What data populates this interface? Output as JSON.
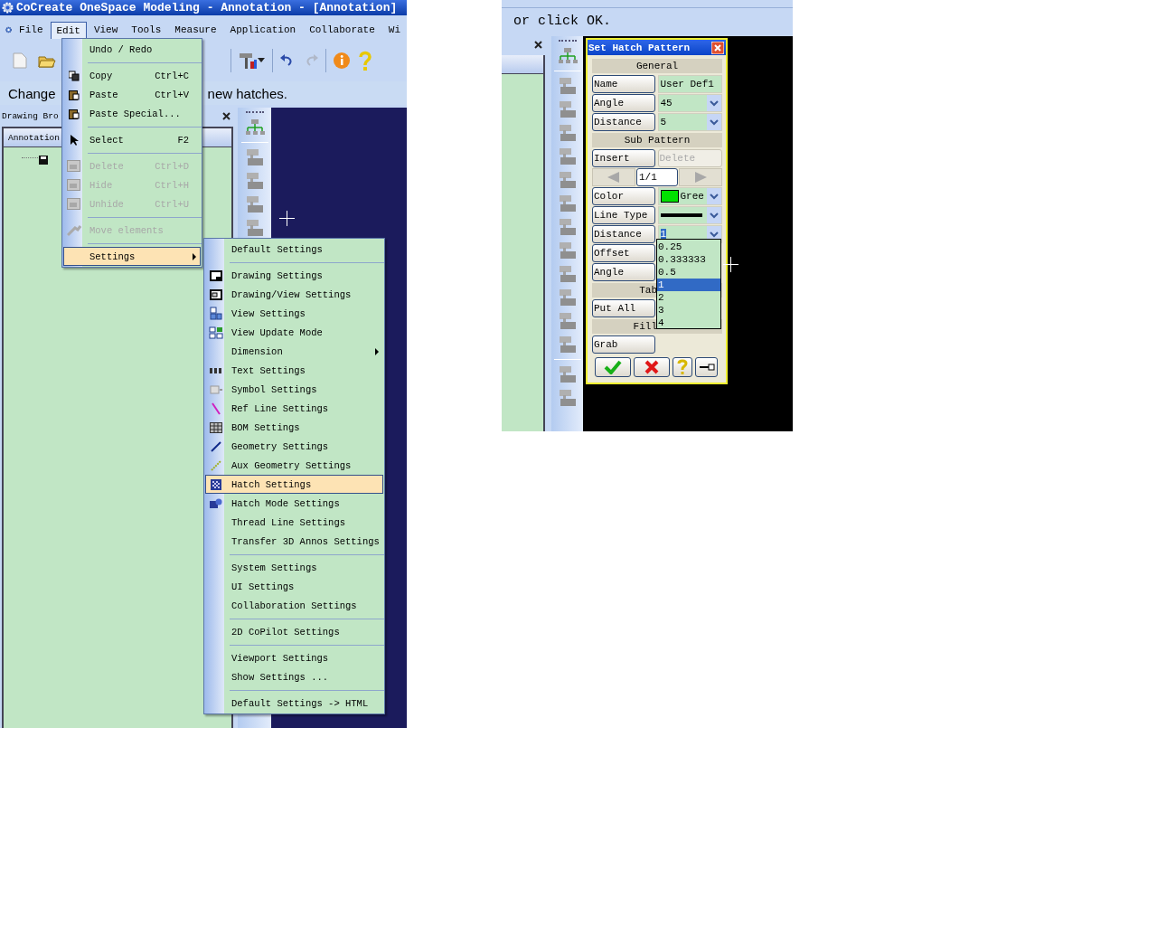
{
  "left_window": {
    "title": "CoCreate OneSpace Modeling - Annotation - [Annotation]",
    "menu_bar": [
      {
        "label": "File",
        "selected": false
      },
      {
        "label": "Edit",
        "selected": true
      },
      {
        "label": "View",
        "selected": false
      },
      {
        "label": "Tools",
        "selected": false
      },
      {
        "label": "Measure",
        "selected": false
      },
      {
        "label": "Application",
        "selected": false
      },
      {
        "label": "Collaborate",
        "selected": false
      },
      {
        "label": "Wi",
        "selected": false
      }
    ],
    "prompt": [
      "Change",
      "new hatches."
    ],
    "browser": {
      "title": "Drawing Bro",
      "tab": "Annotation"
    },
    "edit_menu": [
      {
        "kind": "item",
        "label": "Undo / Redo",
        "disabled": false,
        "selected": false
      },
      {
        "kind": "separator"
      },
      {
        "kind": "item",
        "label": "Copy",
        "shortcut": "Ctrl+C",
        "disabled": false,
        "selected": false
      },
      {
        "kind": "item",
        "label": "Paste",
        "shortcut": "Ctrl+V",
        "disabled": false,
        "selected": false
      },
      {
        "kind": "item",
        "label": "Paste Special...",
        "disabled": false,
        "selected": false
      },
      {
        "kind": "separator"
      },
      {
        "kind": "item",
        "label": "Select",
        "shortcut": "F2",
        "disabled": false,
        "selected": false
      },
      {
        "kind": "separator"
      },
      {
        "kind": "item",
        "label": "Delete",
        "shortcut": "Ctrl+D",
        "disabled": true,
        "selected": false
      },
      {
        "kind": "item",
        "label": "Hide",
        "shortcut": "Ctrl+H",
        "disabled": true,
        "selected": false
      },
      {
        "kind": "item",
        "label": "Unhide",
        "shortcut": "Ctrl+U",
        "disabled": true,
        "selected": false
      },
      {
        "kind": "separator"
      },
      {
        "kind": "item",
        "label": "Move elements",
        "disabled": true,
        "selected": false
      },
      {
        "kind": "separator"
      },
      {
        "kind": "submenu",
        "label": "Settings",
        "disabled": false,
        "selected": true
      }
    ],
    "settings_menu": [
      {
        "kind": "item",
        "label": "Default Settings",
        "disabled": false,
        "selected": false
      },
      {
        "kind": "separator"
      },
      {
        "kind": "item",
        "label": "Drawing Settings",
        "disabled": false,
        "selected": false
      },
      {
        "kind": "item",
        "label": "Drawing/View Settings",
        "disabled": false,
        "selected": false
      },
      {
        "kind": "item",
        "label": "View Settings",
        "disabled": false,
        "selected": false
      },
      {
        "kind": "item",
        "label": "View Update Mode",
        "disabled": false,
        "selected": false
      },
      {
        "kind": "submenu",
        "label": "Dimension",
        "disabled": false,
        "selected": false
      },
      {
        "kind": "item",
        "label": "Text Settings",
        "disabled": false,
        "selected": false
      },
      {
        "kind": "item",
        "label": "Symbol Settings",
        "disabled": false,
        "selected": false
      },
      {
        "kind": "item",
        "label": "Ref Line Settings",
        "disabled": false,
        "selected": false
      },
      {
        "kind": "item",
        "label": "BOM Settings",
        "disabled": false,
        "selected": false
      },
      {
        "kind": "item",
        "label": "Geometry Settings",
        "disabled": false,
        "selected": false
      },
      {
        "kind": "item",
        "label": "Aux Geometry Settings",
        "disabled": false,
        "selected": false
      },
      {
        "kind": "item",
        "label": "Hatch Settings",
        "disabled": false,
        "selected": true
      },
      {
        "kind": "item",
        "label": "Hatch Mode Settings",
        "disabled": false,
        "selected": false
      },
      {
        "kind": "item",
        "label": "Thread Line Settings",
        "disabled": false,
        "selected": false
      },
      {
        "kind": "item",
        "label": "Transfer 3D Annos Settings",
        "disabled": false,
        "selected": false
      },
      {
        "kind": "separator"
      },
      {
        "kind": "item",
        "label": "System Settings",
        "disabled": false,
        "selected": false
      },
      {
        "kind": "item",
        "label": "UI Settings",
        "disabled": false,
        "selected": false
      },
      {
        "kind": "item",
        "label": "Collaboration Settings",
        "disabled": false,
        "selected": false
      },
      {
        "kind": "separator"
      },
      {
        "kind": "item",
        "label": "2D CoPilot Settings",
        "disabled": false,
        "selected": false
      },
      {
        "kind": "separator"
      },
      {
        "kind": "item",
        "label": "Viewport Settings",
        "disabled": false,
        "selected": false
      },
      {
        "kind": "item",
        "label": "Show Settings ...",
        "disabled": false,
        "selected": false
      },
      {
        "kind": "separator"
      },
      {
        "kind": "item",
        "label": "Default Settings -> HTML",
        "disabled": false,
        "selected": false
      }
    ]
  },
  "right_window": {
    "prompt": "or click OK.",
    "dialog": {
      "title": "Set Hatch Pattern",
      "rows": [
        {
          "kind": "section",
          "label": "General"
        },
        {
          "kind": "field",
          "label": "Name",
          "value": "User Def1"
        },
        {
          "kind": "combo",
          "label": "Angle",
          "value": "45",
          "text_selected": false
        },
        {
          "kind": "combo",
          "label": "Distance",
          "value": "5",
          "text_selected": false
        },
        {
          "kind": "section",
          "label": "Sub Pattern"
        },
        {
          "kind": "buttons",
          "buttons": [
            {
              "label": "Insert",
              "disabled": false
            },
            {
              "label": "Delete",
              "disabled": true
            }
          ]
        },
        {
          "kind": "pager",
          "value": "1/1"
        },
        {
          "kind": "color",
          "label": "Color",
          "value": "Gree",
          "color": "#00e000"
        },
        {
          "kind": "linetype",
          "label": "Line Type"
        },
        {
          "kind": "combo",
          "label": "Distance",
          "value": "1",
          "text_selected": true
        },
        {
          "kind": "button",
          "label": "Offset"
        },
        {
          "kind": "button",
          "label": "Angle"
        },
        {
          "kind": "section_cut",
          "label": "Tab"
        },
        {
          "kind": "button",
          "label": "Put All"
        },
        {
          "kind": "section_cut",
          "label": "Fill"
        },
        {
          "kind": "button",
          "label": "Grab"
        },
        {
          "kind": "actions"
        }
      ],
      "dropdown": [
        {
          "label": "0.25",
          "selected": false
        },
        {
          "label": "0.333333",
          "selected": false
        },
        {
          "label": "0.5",
          "selected": false
        },
        {
          "label": "1",
          "selected": true
        },
        {
          "label": "2",
          "selected": false
        },
        {
          "label": "3",
          "selected": false
        },
        {
          "label": "4",
          "selected": false
        }
      ]
    }
  }
}
